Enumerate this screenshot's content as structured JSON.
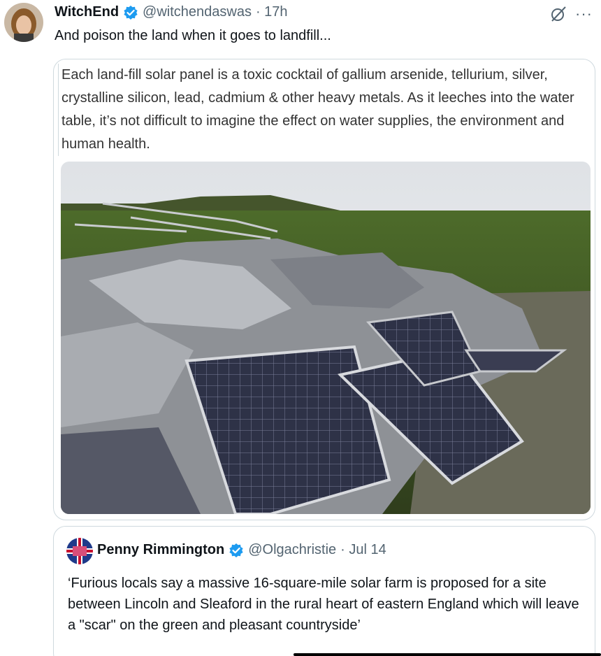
{
  "tweet": {
    "author_name": "WitchEnd",
    "author_handle": "@witchendaswas",
    "time": "· 17h",
    "text": "And poison the land when it goes to landfill...",
    "more_label": "···"
  },
  "media_quote": {
    "text": "Each land-fill solar panel is a toxic cocktail of gallium arsenide, tellurium, silver, crystalline silicon, lead, cadmium & other heavy metals. As it leeches into the water table, it’s not difficult to imagine the effect on water supplies, the environment and human health."
  },
  "quoted_tweet": {
    "author_name": "Penny Rimmington",
    "author_handle": "@Olgachristie",
    "time": "· Jul 14",
    "text": "‘Furious locals say a massive 16-square-mile solar farm is proposed for a site between Lincoln and Sleaford in the rural heart of eastern England which will leave a \"scar\" on the green and pleasant countryside’"
  },
  "colors": {
    "verified": "#1d9bf0",
    "text": "#0f1419",
    "secondary": "#536471",
    "border": "#cfd9de"
  }
}
